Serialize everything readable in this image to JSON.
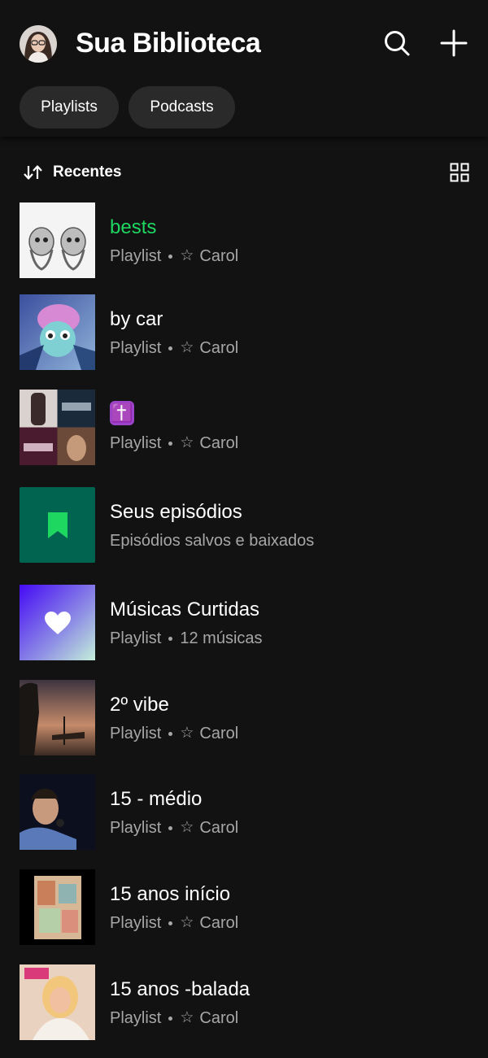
{
  "header": {
    "title": "Sua Biblioteca",
    "avatar_icon": "user-avatar",
    "search_icon": "search-icon",
    "add_icon": "plus-icon"
  },
  "filters": {
    "playlists": "Playlists",
    "podcasts": "Podcasts"
  },
  "sort": {
    "label": "Recentes",
    "sort_icon": "sort-arrows-icon",
    "view_icon": "grid-view-icon"
  },
  "colors": {
    "background": "#121212",
    "accent": "#1ed760",
    "chip": "#2a2a2a",
    "subtext": "#a7a7a7",
    "episodes_tile": "#006450"
  },
  "items": [
    {
      "title": "bests",
      "type": "Playlist",
      "owner": "Carol",
      "active": true
    },
    {
      "title": "by car",
      "type": "Playlist",
      "owner": "Carol"
    },
    {
      "title": "✝️",
      "type": "Playlist",
      "owner": "Carol"
    },
    {
      "title": "Seus episódios",
      "subtitle": "Episódios salvos e baixados",
      "icon": "bookmark-icon"
    },
    {
      "title": "Músicas Curtidas",
      "type": "Playlist",
      "count": "12 músicas",
      "icon": "heart-icon"
    },
    {
      "title": "2º vibe",
      "type": "Playlist",
      "owner": "Carol"
    },
    {
      "title": "15 - médio",
      "type": "Playlist",
      "owner": "Carol"
    },
    {
      "title": "15 anos início",
      "type": "Playlist",
      "owner": "Carol"
    },
    {
      "title": "15 anos -balada",
      "type": "Playlist",
      "owner": "Carol"
    }
  ]
}
